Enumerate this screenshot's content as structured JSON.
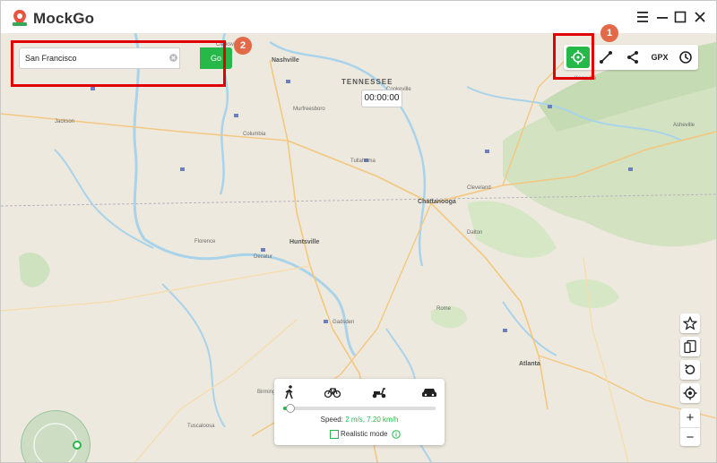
{
  "app": {
    "name": "MockGo"
  },
  "window_controls": {
    "menu": "menu-icon",
    "minimize": "minimize-icon",
    "maximize": "maximize-icon",
    "close": "close-icon"
  },
  "search": {
    "value": "San Francisco",
    "go_label": "Go"
  },
  "badges": {
    "one": "1",
    "two": "2"
  },
  "timer": "00:00:00",
  "toolbar": {
    "gpx_label": "GPX"
  },
  "map": {
    "state_label": "TENNESSEE",
    "cities": [
      {
        "name": "Nashville",
        "big": true
      },
      {
        "name": "Huntsville",
        "big": true
      },
      {
        "name": "Chattanooga",
        "big": true
      },
      {
        "name": "Atlanta",
        "big": true
      },
      {
        "name": "Knoxville",
        "big": false
      },
      {
        "name": "Murfreesboro",
        "big": false
      },
      {
        "name": "Clarksville",
        "big": false
      },
      {
        "name": "Florence",
        "big": false
      },
      {
        "name": "Decatur",
        "big": false
      },
      {
        "name": "Gadsden",
        "big": false
      },
      {
        "name": "Rome",
        "big": false
      },
      {
        "name": "Dalton",
        "big": false
      },
      {
        "name": "Cleveland",
        "big": false
      },
      {
        "name": "Tullahoma",
        "big": false
      },
      {
        "name": "Columbia",
        "big": false
      },
      {
        "name": "Cookeville",
        "big": false
      },
      {
        "name": "Tuscaloosa",
        "big": false
      },
      {
        "name": "Birmingham",
        "big": false
      },
      {
        "name": "Jackson",
        "big": false
      },
      {
        "name": "Asheville",
        "big": false
      }
    ]
  },
  "speed_panel": {
    "speed_label": "Speed:",
    "speed_value": "2 m/s, 7.20 km/h",
    "speed_fraction": 0.04,
    "realistic_label": "Realistic mode"
  },
  "colors": {
    "accent": "#27b84a",
    "highlight": "#e00000",
    "badge": "#e36a48",
    "water": "#a9d3ea",
    "park": "#cfe2bf"
  }
}
